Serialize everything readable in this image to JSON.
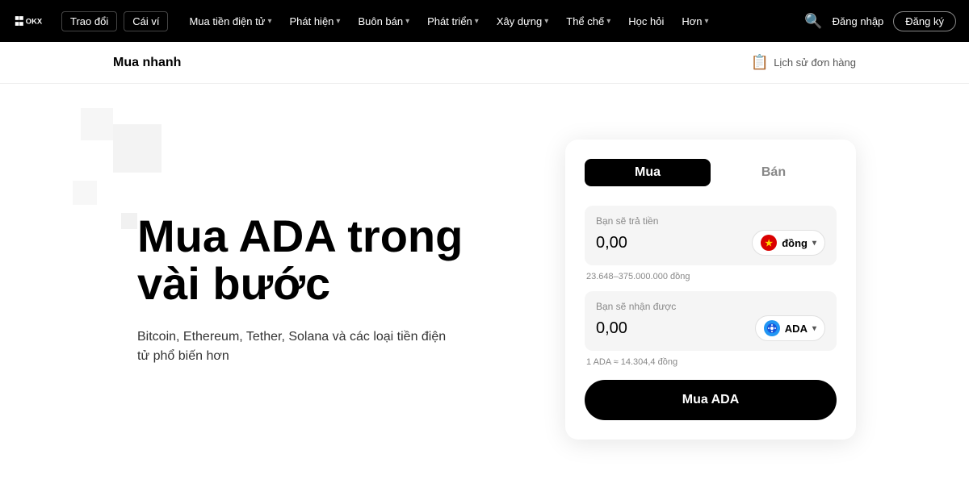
{
  "navbar": {
    "exchange_btn": "Trao đổi",
    "wallet_btn": "Cái ví",
    "items": [
      {
        "label": "Mua tiền điện tử",
        "has_dropdown": true
      },
      {
        "label": "Phát hiện",
        "has_dropdown": true
      },
      {
        "label": "Buôn bán",
        "has_dropdown": true
      },
      {
        "label": "Phát triển",
        "has_dropdown": true
      },
      {
        "label": "Xây dựng",
        "has_dropdown": true
      },
      {
        "label": "Thể chế",
        "has_dropdown": true
      },
      {
        "label": "Học hỏi",
        "has_dropdown": false
      },
      {
        "label": "Hơn",
        "has_dropdown": true
      }
    ],
    "login": "Đăng nhập",
    "register": "Đăng ký"
  },
  "subheader": {
    "title": "Mua nhanh",
    "order_history": "Lịch sử đơn hàng"
  },
  "hero": {
    "heading_line1": "Mua ADA trong",
    "heading_line2": "vài bước",
    "subtext": "Bitcoin, Ethereum, Tether, Solana và các loại tiền điện tử phổ biến hơn"
  },
  "trade_card": {
    "tab_buy": "Mua",
    "tab_sell": "Bán",
    "pay_label": "Bạn sẽ trả tiền",
    "pay_value": "0,00",
    "pay_currency": "đồng",
    "range_text": "23.648–375.000.000 đồng",
    "receive_label": "Bạn sẽ nhận được",
    "receive_value": "0,00",
    "receive_currency": "ADA",
    "rate_text": "1 ADA ≈ 14.304,4 đồng",
    "buy_button": "Mua ADA"
  },
  "icons": {
    "search": "🔍",
    "order_history": "📋",
    "chevron": "▾",
    "star": "★"
  }
}
